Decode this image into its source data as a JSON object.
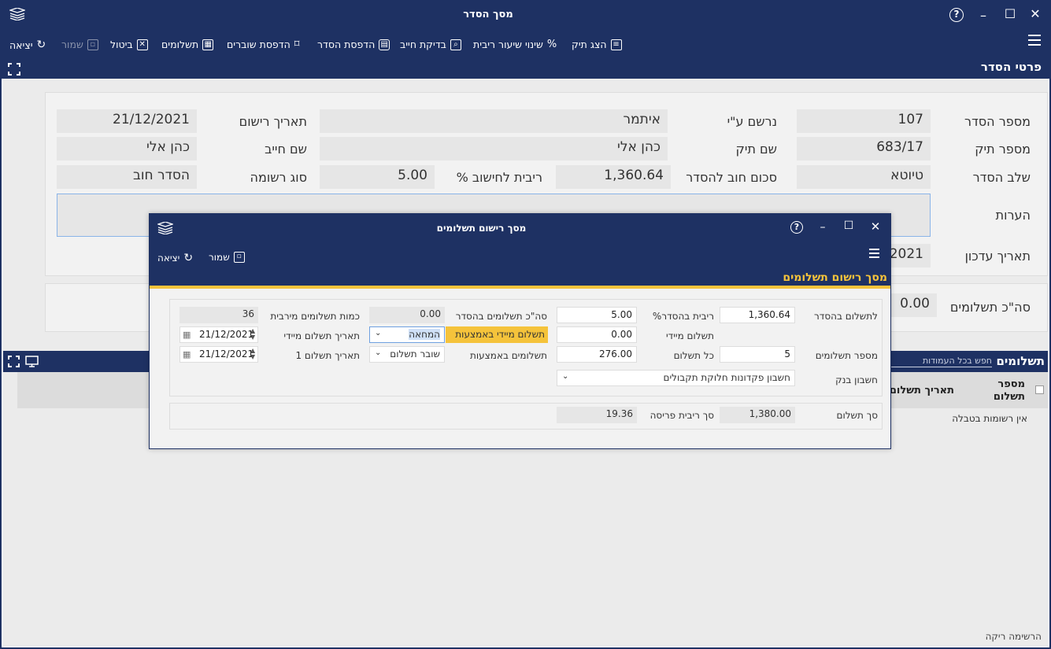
{
  "window": {
    "title": "מסך הסדר"
  },
  "toolbar": {
    "show_file": "הצג תיק",
    "change_interest": "שינוי שיעור ריבית",
    "check_debtor": "בדיקת חייב",
    "print_settlement": "הדפסת הסדר",
    "print_vouchers": "הדפסת שוברים",
    "payments": "תשלומים",
    "cancel": "ביטול",
    "save": "שמור",
    "exit": "יציאה"
  },
  "section": {
    "title": "פרטי הסדר"
  },
  "details": {
    "settlement_number_label": "מספר הסדר",
    "settlement_number": "107",
    "registered_by_label": "נרשם ע\"י",
    "registered_by": "איתמר",
    "registration_date_label": "תאריך רישום",
    "registration_date": "21/12/2021",
    "file_number_label": "מספר תיק",
    "file_number": "683/17",
    "file_name_label": "שם תיק",
    "file_name": "כהן אלי",
    "debtor_name_label": "שם חייב",
    "debtor_name": "כהן אלי",
    "stage_label": "שלב הסדר",
    "stage": "טיוטא",
    "debt_amount_label": "סכום חוב להסדר",
    "debt_amount": "1,360.64",
    "interest_label": "% ריבית לחישוב",
    "interest": "5.00",
    "record_type_label": "סוג רשומה",
    "record_type": "הסדר חוב",
    "notes_label": "הערות",
    "update_date_label": "תאריך עדכון",
    "update_date_partial": "/2021",
    "total_payments_label": "סה\"כ תשלומים",
    "total_payments": "0.00"
  },
  "payments_panel": {
    "title": "תשלומים",
    "search_placeholder": "חפש בכל העמודות",
    "col_payment_number": "מספר תשלום",
    "col_payment_date": "תאריך תשלום",
    "empty_text": "אין רשומות בטבלה",
    "footer": "הרשימה ריקה"
  },
  "dialog": {
    "title": "מסך רישום תשלומים",
    "save": "שמור",
    "exit": "יציאה",
    "header": "מסך רישום תשלומים",
    "accent": "#f5c33b",
    "fields": {
      "settlement_payment_label": "לתשלום בהסדר",
      "settlement_payment": "1,360.64",
      "settlement_interest_label": "%ריבית בהסדר",
      "settlement_interest": "5.00",
      "total_settlement_payments_label": "סה\"כ תשלומים בהסדר",
      "total_settlement_payments": "0.00",
      "max_payments_label": "כמות תשלומים מירבית",
      "max_payments": "36",
      "immediate_payment_label": "תשלום מיידי",
      "immediate_payment": "0.00",
      "immediate_by_label": "תשלום מיידי באמצעות",
      "immediate_by": "המחאה",
      "immediate_date_label": "תאריך תשלום מיידי",
      "immediate_date": "21/12/2021",
      "num_payments_label": "מספר תשלומים",
      "num_payments": "5",
      "each_payment_label": "כל תשלום",
      "each_payment": "276.00",
      "payments_by_label": "תשלומים באמצעות",
      "payments_by": "שובר תשלום",
      "first_payment_date_label": "תאריך תשלום 1",
      "first_payment_date": "21/12/2021",
      "bank_account_label": "חשבון בנק",
      "bank_account": "חשבון פקדונות חלוקת תקבולים",
      "payment_total_label": "סך תשלום",
      "payment_total": "1,380.00",
      "spread_interest_label": "סך ריבית פריסה",
      "spread_interest": "19.36"
    }
  }
}
